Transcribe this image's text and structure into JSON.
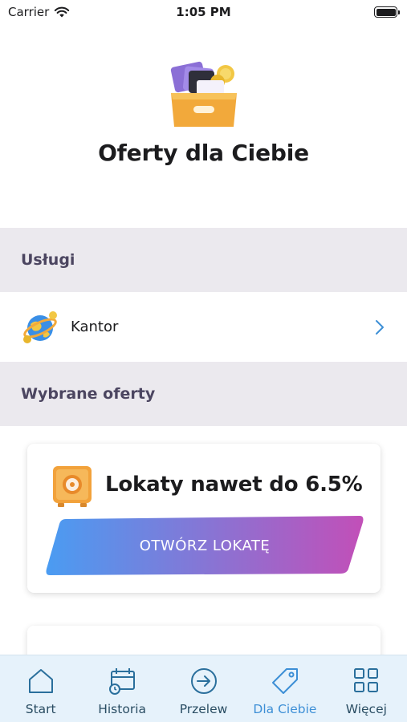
{
  "status_bar": {
    "carrier": "Carrier",
    "time": "1:05 PM"
  },
  "page": {
    "title": "Oferty dla Ciebie"
  },
  "sections": {
    "services_header": "Usługi",
    "offers_header": "Wybrane oferty"
  },
  "services": [
    {
      "label": "Kantor",
      "icon": "globe-coins-icon"
    }
  ],
  "offers": [
    {
      "title": "Lokaty nawet do 6.5%",
      "button_label": "OTWÓRZ LOKATĘ",
      "icon": "safe-icon"
    }
  ],
  "tabs": [
    {
      "label": "Start",
      "icon": "home-icon",
      "active": false
    },
    {
      "label": "Historia",
      "icon": "history-calendar-icon",
      "active": false
    },
    {
      "label": "Przelew",
      "icon": "transfer-arrow-icon",
      "active": false
    },
    {
      "label": "Dla Ciebie",
      "icon": "tag-icon",
      "active": true
    },
    {
      "label": "Więcej",
      "icon": "grid-icon",
      "active": false
    }
  ],
  "colors": {
    "accent": "#3d8fd6",
    "section_bg": "#ebe9ee",
    "tab_bar_bg": "#e6f2fb",
    "button_gradient_start": "#4a9cf2",
    "button_gradient_end": "#c24fb8"
  }
}
